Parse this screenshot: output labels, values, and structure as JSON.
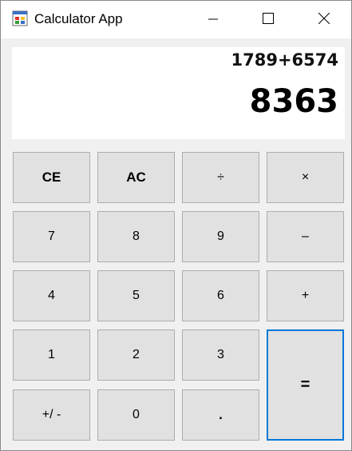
{
  "window": {
    "title": "Calculator App",
    "app_icon": "windows-form-icon",
    "controls": {
      "minimize_icon": "minimize-icon",
      "maximize_icon": "maximize-icon",
      "close_icon": "close-icon"
    }
  },
  "display": {
    "expression": "1789+6574",
    "result": "8363"
  },
  "keys": {
    "ce": "CE",
    "ac": "AC",
    "divide": "÷",
    "multiply": "×",
    "seven": "7",
    "eight": "8",
    "nine": "9",
    "minus": "–",
    "four": "4",
    "five": "5",
    "six": "6",
    "plus": "+",
    "one": "1",
    "two": "2",
    "three": "3",
    "equals": "=",
    "negate": "+/ -",
    "zero": "0",
    "decimal": "."
  },
  "colors": {
    "focus_border": "#0078d7",
    "key_background": "#e1e1e1",
    "form_background": "#f0f0f0"
  }
}
